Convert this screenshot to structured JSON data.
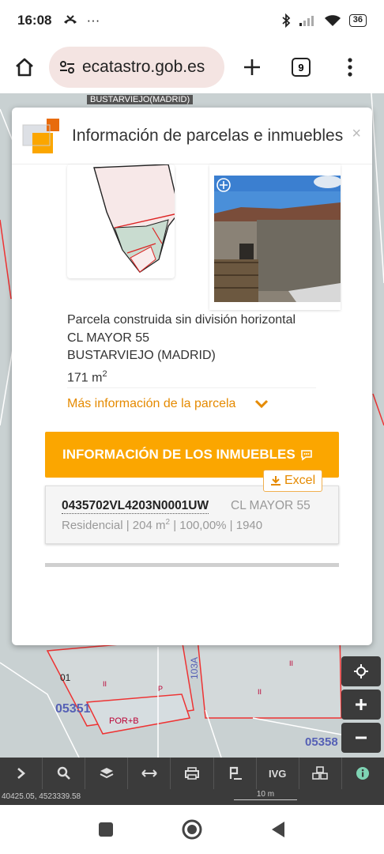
{
  "status": {
    "time": "16:08",
    "battery": "36"
  },
  "browser": {
    "url": "ecatastro.gob.es",
    "tab_count": "9"
  },
  "map": {
    "top_label": "BUSTARVIEJO(MADRID)",
    "coords": "40425.05, 4523339.58",
    "scale": "10 m",
    "labels": [
      "01",
      "05351",
      "POR+B",
      "103A",
      "05358",
      "P",
      "II",
      "II",
      "II"
    ]
  },
  "modal": {
    "title": "Información de parcelas e inmuebles",
    "close_label": "×",
    "parcel": {
      "type": "Parcela construida sin división horizontal",
      "address": "CL MAYOR 55",
      "municipality": "BUSTARVIEJO (MADRID)",
      "area": "171 m",
      "area_unit_sup": "2"
    },
    "more_info_label": "Más información de la parcela",
    "inmuebles_header": "INFORMACIÓN DE LOS INMUEBLES",
    "excel_label": "Excel",
    "inmueble": {
      "ref": "0435702VL4203N0001UW",
      "address": "CL MAYOR 55",
      "use": "Residencial",
      "area": "204 m",
      "area_unit_sup": "2",
      "share": "100,00%",
      "year": "1940"
    }
  },
  "bottom_toolbar": {
    "ivg_label": "IVG"
  },
  "colors": {
    "accent_orange": "#fba600",
    "link_orange": "#e58a00",
    "dark_ctl": "#3b3b3b"
  }
}
